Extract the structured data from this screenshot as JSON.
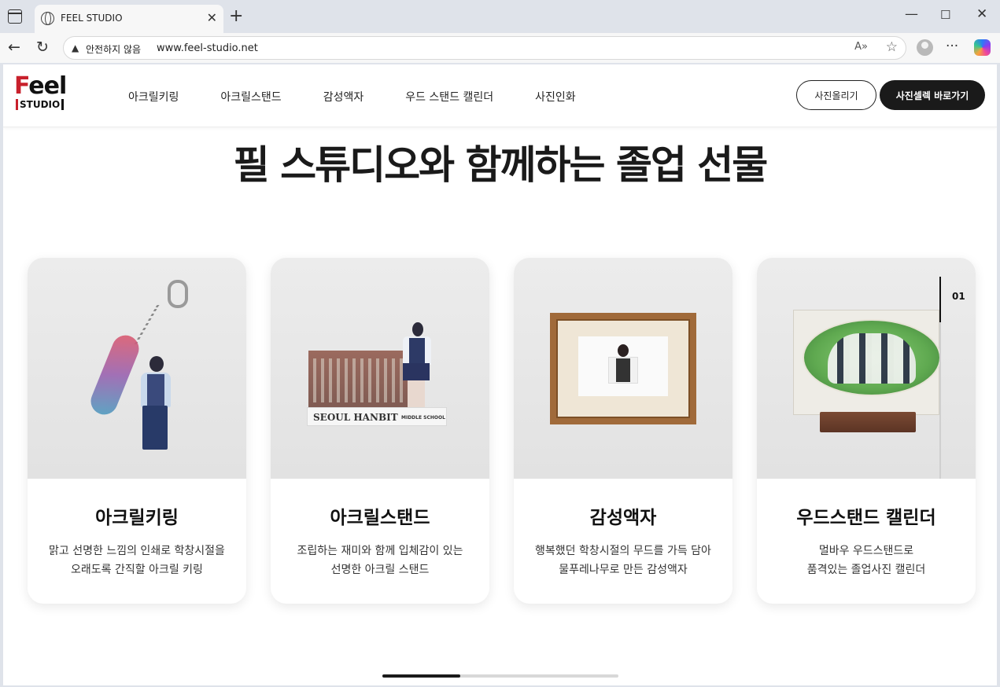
{
  "browser": {
    "tab_title": "FEEL STUDIO",
    "security_label": "안전하지 않음",
    "url": "www.feel-studio.net",
    "icons": [
      "window-icon",
      "globe-icon",
      "close-icon",
      "new-tab-icon",
      "minimize-icon",
      "maximize-icon",
      "back-icon",
      "refresh-icon",
      "warning-icon",
      "read-aloud-icon",
      "favorite-star-icon",
      "profile-icon",
      "more-icon",
      "copilot-icon"
    ]
  },
  "header": {
    "logo_text": "Feel",
    "logo_sub": "STUDIO",
    "nav": [
      "아크릴키링",
      "아크릴스탠드",
      "감성액자",
      "우드 스탠드 캘린더",
      "사진인화"
    ],
    "upload_button": "사진올리기",
    "select_button": "사진셀렉 바로가기"
  },
  "main": {
    "title": "필 스튜디오와 함께하는 졸업 선물",
    "cards": [
      {
        "title": "아크릴키링",
        "desc_line1": "맑고 선명한 느낌의 인쇄로 학창시절을",
        "desc_line2": "오래도록 간직할 아크릴 키링"
      },
      {
        "title": "아크릴스탠드",
        "desc_line1": "조립하는 재미와 함께 입체감이 있는",
        "desc_line2": "선명한 아크릴 스탠드",
        "image_text": "SEOUL HANBIT",
        "image_subtext": "MIDDLE SCHOOL"
      },
      {
        "title": "감성액자",
        "desc_line1": "행복했던 학창시절의 무드를 가득 담아",
        "desc_line2": "물푸레나무로 만든 감성액자"
      },
      {
        "title": "우드스탠드 캘린더",
        "desc_line1": "멀바우 우드스탠드로",
        "desc_line2": "품격있는 졸업사진 캘린더",
        "slide_number": "01"
      }
    ],
    "carousel_progress": 0.33
  },
  "colors": {
    "brand_red": "#c8202c",
    "dark": "#1a1a1a"
  }
}
